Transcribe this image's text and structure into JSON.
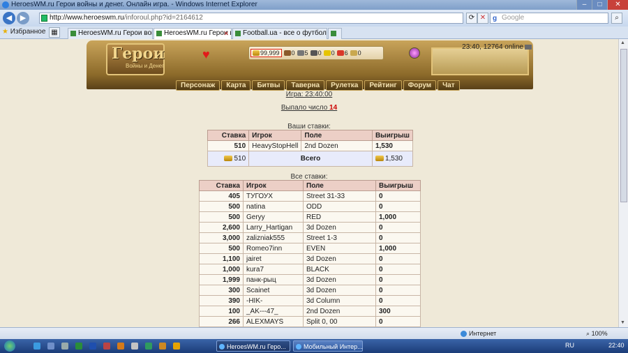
{
  "window": {
    "title": "HeroesWM.ru Герои войны и денег. Онлайн игра. - Windows Internet Explorer"
  },
  "address": {
    "url_host": "http://www.heroeswm.ru",
    "url_path": "/inforoul.php?id=2164612",
    "search_placeholder": "Google"
  },
  "favorites_label": "Избранное",
  "tabs": [
    {
      "label": "HeroesWM.ru Герои войн..."
    },
    {
      "label": "HeroesWM.ru Герои войн..."
    },
    {
      "label": "Football.ua - все о футболе"
    }
  ],
  "header": {
    "logo": "Герои",
    "logo_sub": "Войны и Денег",
    "gold": "99,999",
    "resources": [
      "0",
      "5",
      "0",
      "0",
      "6",
      "0"
    ],
    "online_text": "23:40, 12764 online"
  },
  "menu": [
    "Персонаж",
    "Карта",
    "Битвы",
    "Таверна",
    "Рулетка",
    "Рейтинг",
    "Форум",
    "Чат"
  ],
  "game": {
    "game_label": "Игра: 23:40:00",
    "drop_label": "Выпало число",
    "drop_number": "14"
  },
  "your_bets": {
    "caption": "Ваши ставки:",
    "headers": [
      "Ставка",
      "Игрок",
      "Поле",
      "Выигрыш"
    ],
    "rows": [
      [
        "510",
        "HeavyStopHell",
        "2nd Dozen",
        "1,530"
      ]
    ],
    "total": {
      "stake": "510",
      "label": "Всего",
      "win": "1,530"
    }
  },
  "all_bets": {
    "caption": "Все ставки:",
    "headers": [
      "Ставка",
      "Игрок",
      "Поле",
      "Выигрыш"
    ],
    "rows": [
      [
        "405",
        "ТУГОУХ",
        "Street 31-33",
        "0"
      ],
      [
        "500",
        "natina",
        "ODD",
        "0"
      ],
      [
        "500",
        "Geryy",
        "RED",
        "1,000"
      ],
      [
        "2,600",
        "Larry_Hartigan",
        "3d Dozen",
        "0"
      ],
      [
        "3,000",
        "zalizniak555",
        "Street 1-3",
        "0"
      ],
      [
        "500",
        "Romeo7inn",
        "EVEN",
        "1,000"
      ],
      [
        "1,100",
        "jairet",
        "3d Dozen",
        "0"
      ],
      [
        "1,000",
        "kura7",
        "BLACK",
        "0"
      ],
      [
        "1,999",
        "панк-рыц",
        "3d Dozen",
        "0"
      ],
      [
        "300",
        "Scainet",
        "3d Dozen",
        "0"
      ],
      [
        "390",
        "-НIK-",
        "3d Column",
        "0"
      ],
      [
        "100",
        "_AK---47_",
        "2nd Dozen",
        "300"
      ],
      [
        "266",
        "ALEXMAYS",
        "Split 0, 00",
        "0"
      ]
    ]
  },
  "status": {
    "zone": "Интернет",
    "zoom": "100%"
  },
  "taskbar": {
    "tasks": [
      "HeroesWM.ru Геро...",
      "Мобильный Интер..."
    ],
    "lang": "RU",
    "clock": "22:40"
  },
  "colors": {
    "header_bg": "#eccfc6",
    "total_bg": "#e8ebfb",
    "accent_red": "#cc0000"
  }
}
